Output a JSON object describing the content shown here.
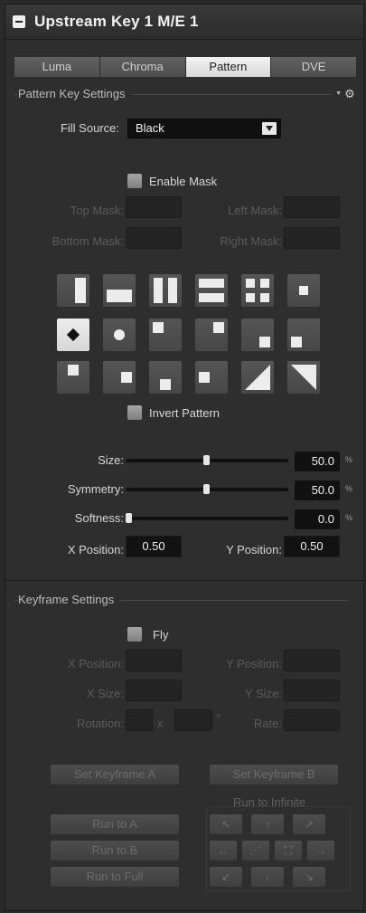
{
  "header": {
    "title": "Upstream Key 1 M/E 1"
  },
  "tabs": [
    {
      "label": "Luma"
    },
    {
      "label": "Chroma"
    },
    {
      "label": "Pattern"
    },
    {
      "label": "DVE"
    }
  ],
  "pattern_section": {
    "title": "Pattern Key Settings",
    "fill_source_label": "Fill Source:",
    "fill_source_value": "Black",
    "enable_mask_label": "Enable Mask",
    "mask": {
      "top": "Top Mask:",
      "left": "Left Mask:",
      "bottom": "Bottom Mask:",
      "right": "Right Mask:"
    },
    "invert_label": "Invert Pattern",
    "size_label": "Size:",
    "size_value": "50.0",
    "size_level": 0.5,
    "symmetry_label": "Symmetry:",
    "symmetry_value": "50.0",
    "symmetry_level": 0.5,
    "softness_label": "Softness:",
    "softness_value": "0.0",
    "softness_level": 0.0,
    "unit": "%",
    "x_position_label": "X Position:",
    "x_position_value": "0.50",
    "y_position_label": "Y Position:",
    "y_position_value": "0.50"
  },
  "keyframe_section": {
    "title": "Keyframe Settings",
    "fly_label": "Fly",
    "x_position_label": "X Position:",
    "y_position_label": "Y Position:",
    "x_size_label": "X Size:",
    "y_size_label": "Y Size:",
    "rotation_label": "Rotation:",
    "x_sep": "x",
    "degree": "°",
    "rate_label": "Rate:",
    "set_a": "Set Keyframe A",
    "set_b": "Set Keyframe B",
    "run_to_infinite": "Run to Infinite",
    "run_a": "Run to A",
    "run_b": "Run to B",
    "run_full": "Run to Full",
    "arrows": {
      "up_left": "↖",
      "up": "↑",
      "up_right": "↗",
      "left": "←",
      "center": "⋰",
      "fullscreen": "⛶",
      "right": "→",
      "down_left": "↙",
      "down": "↓",
      "down_right": "↘"
    }
  }
}
